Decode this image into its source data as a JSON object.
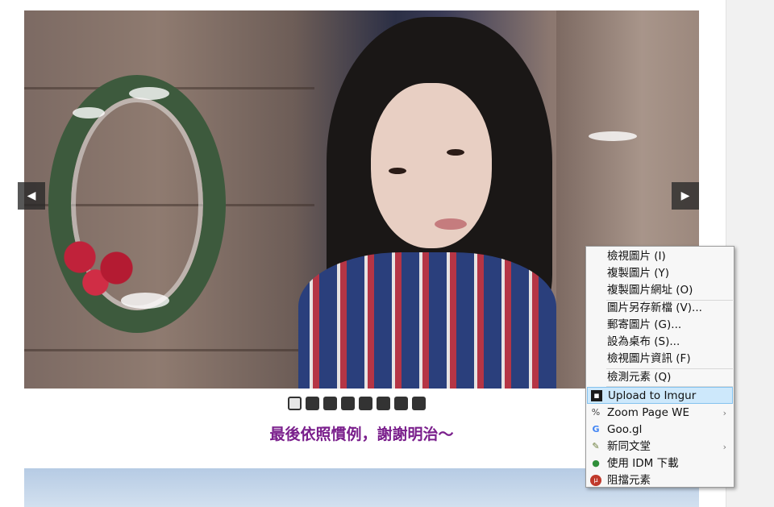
{
  "carousel": {
    "prev_arrow": "◀",
    "next_arrow": "▶",
    "dots": 8,
    "active_dot": 1
  },
  "caption": "最後依照慣例，謝謝明治～",
  "context_menu": {
    "items": [
      {
        "label": "檢視圖片 (I)"
      },
      {
        "label": "複製圖片 (Y)"
      },
      {
        "label": "複製圖片網址 (O)"
      },
      {
        "label": "圖片另存新檔 (V)..."
      },
      {
        "label": "郵寄圖片 (G)..."
      },
      {
        "label": "設為桌布 (S)..."
      },
      {
        "label": "檢視圖片資訊 (F)"
      },
      {
        "label": "檢測元素 (Q)"
      },
      {
        "label": "Upload to Imgur",
        "icon": "imgur-icon"
      },
      {
        "label": "Zoom Page WE",
        "icon": "zoom-icon"
      },
      {
        "label": "Goo.gl",
        "icon": "google-icon"
      },
      {
        "label": "新同文堂",
        "icon": "tongwen-icon"
      },
      {
        "label": "使用 IDM 下載",
        "icon": "idm-icon"
      },
      {
        "label": "阻擋元素",
        "icon": "ublock-icon"
      }
    ],
    "submenu_arrow": "›"
  },
  "colors": {
    "caption": "#7a1f8c",
    "menu_highlight": "#cde8fb"
  }
}
